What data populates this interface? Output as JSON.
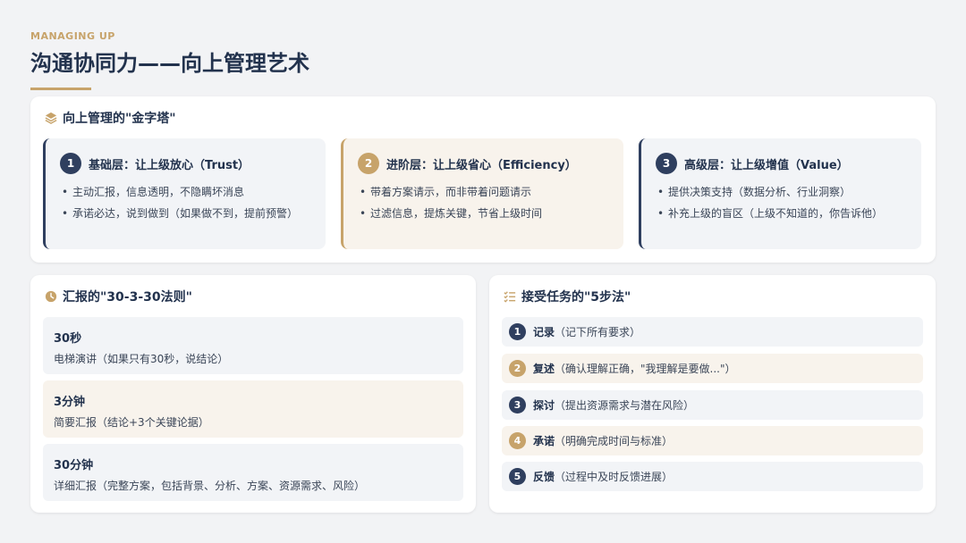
{
  "header": {
    "kicker": "MANAGING UP",
    "title": "沟通协同力——向上管理艺术"
  },
  "pyramid": {
    "icon": "layers-icon",
    "title": "向上管理的\"金字塔\"",
    "levels": [
      {
        "num": "1",
        "title": "基础层：让上级放心（Trust）",
        "bullets": [
          "主动汇报，信息透明，不隐瞒坏消息",
          "承诺必达，说到做到（如果做不到，提前预警）"
        ]
      },
      {
        "num": "2",
        "title": "进阶层：让上级省心（Efficiency）",
        "bullets": [
          "带着方案请示，而非带着问题请示",
          "过滤信息，提炼关键，节省上级时间"
        ]
      },
      {
        "num": "3",
        "title": "高级层：让上级增值（Value）",
        "bullets": [
          "提供决策支持（数据分析、行业洞察）",
          "补充上级的盲区（上级不知道的，你告诉他）"
        ]
      }
    ]
  },
  "report": {
    "icon": "clock-icon",
    "title": "汇报的\"30-3-30法则\"",
    "rules": [
      {
        "time": "30秒",
        "desc": "电梯演讲（如果只有30秒，说结论）"
      },
      {
        "time": "3分钟",
        "desc": "简要汇报（结论+3个关键论据）"
      },
      {
        "time": "30分钟",
        "desc": "详细汇报（完整方案，包括背景、分析、方案、资源需求、风险）"
      }
    ]
  },
  "steps": {
    "icon": "checklist-icon",
    "title": "接受任务的\"5步法\"",
    "items": [
      {
        "num": "1",
        "key": "记录",
        "desc": "（记下所有要求）"
      },
      {
        "num": "2",
        "key": "复述",
        "desc": "（确认理解正确，\"我理解是要做...\"）"
      },
      {
        "num": "3",
        "key": "探讨",
        "desc": "（提出资源需求与潜在风险）"
      },
      {
        "num": "4",
        "key": "承诺",
        "desc": "（明确完成时间与标准）"
      },
      {
        "num": "5",
        "key": "反馈",
        "desc": "（过程中及时反馈进展）"
      }
    ]
  },
  "colors": {
    "navy": "#2f3f5f",
    "gold": "#c7a36a",
    "background": "#f2f3f5"
  }
}
